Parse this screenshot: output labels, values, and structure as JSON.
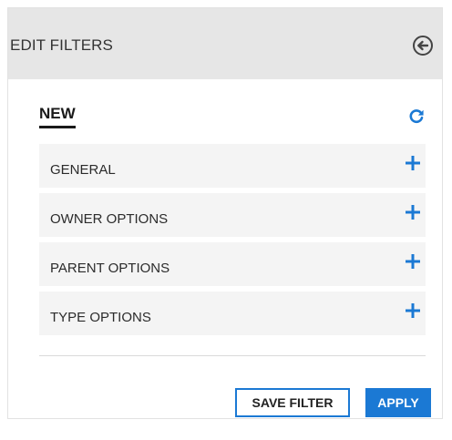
{
  "header": {
    "title": "EDIT FILTERS",
    "back_icon": "circle-arrow-left-icon"
  },
  "filter": {
    "name": "NEW",
    "refresh_icon": "refresh-icon"
  },
  "sections": [
    {
      "label": "GENERAL",
      "icon": "plus-icon"
    },
    {
      "label": "OWNER OPTIONS",
      "icon": "plus-icon"
    },
    {
      "label": "PARENT OPTIONS",
      "icon": "plus-icon"
    },
    {
      "label": "TYPE OPTIONS",
      "icon": "plus-icon"
    }
  ],
  "actions": {
    "save_label": "SAVE FILTER",
    "apply_label": "APPLY"
  },
  "colors": {
    "accent": "#1b79d4",
    "header_bg": "#e6e6e6",
    "row_bg": "#f4f4f4"
  }
}
